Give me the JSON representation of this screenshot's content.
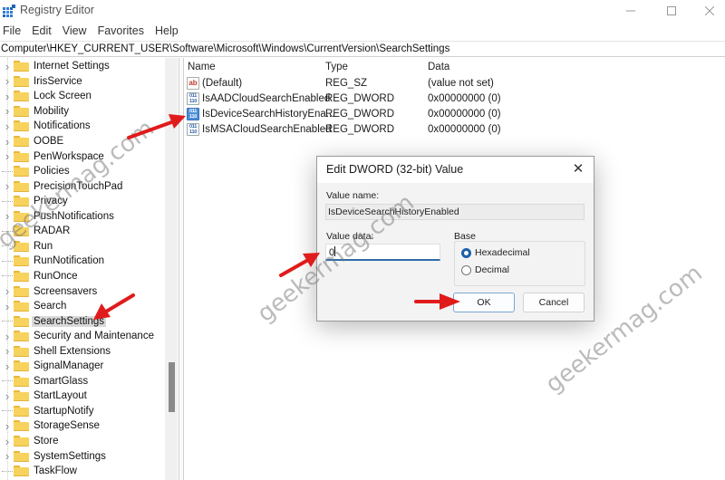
{
  "window": {
    "title": "Registry Editor",
    "controls": {
      "minimize": "—",
      "maximize": "☐",
      "close": "✕"
    }
  },
  "menu": [
    "File",
    "Edit",
    "View",
    "Favorites",
    "Help"
  ],
  "address": "Computer\\HKEY_CURRENT_USER\\Software\\Microsoft\\Windows\\CurrentVersion\\SearchSettings",
  "tree": {
    "items": [
      {
        "label": "Internet Settings",
        "expandable": true
      },
      {
        "label": "IrisService",
        "expandable": true
      },
      {
        "label": "Lock Screen",
        "expandable": true
      },
      {
        "label": "Mobility",
        "expandable": true
      },
      {
        "label": "Notifications",
        "expandable": true
      },
      {
        "label": "OOBE",
        "expandable": true
      },
      {
        "label": "PenWorkspace",
        "expandable": true
      },
      {
        "label": "Policies",
        "expandable": false
      },
      {
        "label": "PrecisionTouchPad",
        "expandable": true
      },
      {
        "label": "Privacy",
        "expandable": false
      },
      {
        "label": "PushNotifications",
        "expandable": true
      },
      {
        "label": "RADAR",
        "expandable": false
      },
      {
        "label": "Run",
        "expandable": false
      },
      {
        "label": "RunNotification",
        "expandable": false
      },
      {
        "label": "RunOnce",
        "expandable": false
      },
      {
        "label": "Screensavers",
        "expandable": true
      },
      {
        "label": "Search",
        "expandable": true
      },
      {
        "label": "SearchSettings",
        "expandable": false,
        "selected": true
      },
      {
        "label": "Security and Maintenance",
        "expandable": true
      },
      {
        "label": "Shell Extensions",
        "expandable": true
      },
      {
        "label": "SignalManager",
        "expandable": true
      },
      {
        "label": "SmartGlass",
        "expandable": false
      },
      {
        "label": "StartLayout",
        "expandable": true
      },
      {
        "label": "StartupNotify",
        "expandable": false
      },
      {
        "label": "StorageSense",
        "expandable": true
      },
      {
        "label": "Store",
        "expandable": true
      },
      {
        "label": "SystemSettings",
        "expandable": true
      },
      {
        "label": "TaskFlow",
        "expandable": false
      }
    ]
  },
  "values": {
    "headers": {
      "name": "Name",
      "type": "Type",
      "data": "Data"
    },
    "rows": [
      {
        "icon": "string-value-icon",
        "name": "(Default)",
        "type": "REG_SZ",
        "data": "(value not set)"
      },
      {
        "icon": "binary-value-icon",
        "name": "IsAADCloudSearchEnabled",
        "type": "REG_DWORD",
        "data": "0x00000000 (0)"
      },
      {
        "icon": "binary-value-icon",
        "name": "IsDeviceSearchHistoryEna...",
        "type": "REG_DWORD",
        "data": "0x00000000 (0)",
        "selected": true
      },
      {
        "icon": "binary-value-icon",
        "name": "IsMSACloudSearchEnabled",
        "type": "REG_DWORD",
        "data": "0x00000000 (0)"
      }
    ]
  },
  "dialog": {
    "title": "Edit DWORD (32-bit) Value",
    "close": "✕",
    "value_name_label": "Value name:",
    "value_name": "IsDeviceSearchHistoryEnabled",
    "value_data_label": "Value data:",
    "value_data": "0",
    "base_label": "Base",
    "base_options": [
      {
        "label": "Hexadecimal",
        "checked": true
      },
      {
        "label": "Decimal",
        "checked": false
      }
    ],
    "ok_label": "OK",
    "cancel_label": "Cancel"
  },
  "watermark": "geekermag.com",
  "colors": {
    "annotation_arrow": "#e01b1b",
    "focus_underline": "#2d6ba8",
    "selected_row": "#d9d9d9"
  }
}
